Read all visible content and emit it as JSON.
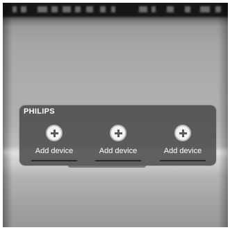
{
  "panel": {
    "brand": "PHILIPS",
    "slots": [
      {
        "label": "Add device",
        "icon": "add-circle-icon"
      },
      {
        "label": "Add device",
        "icon": "add-circle-icon"
      },
      {
        "label": "Add device",
        "icon": "add-circle-icon"
      }
    ]
  },
  "colors": {
    "panel_bg": "#464646",
    "icon_fill": "#f4f4f4",
    "icon_plus": "#5a5a5a",
    "text": "#ffffff"
  }
}
